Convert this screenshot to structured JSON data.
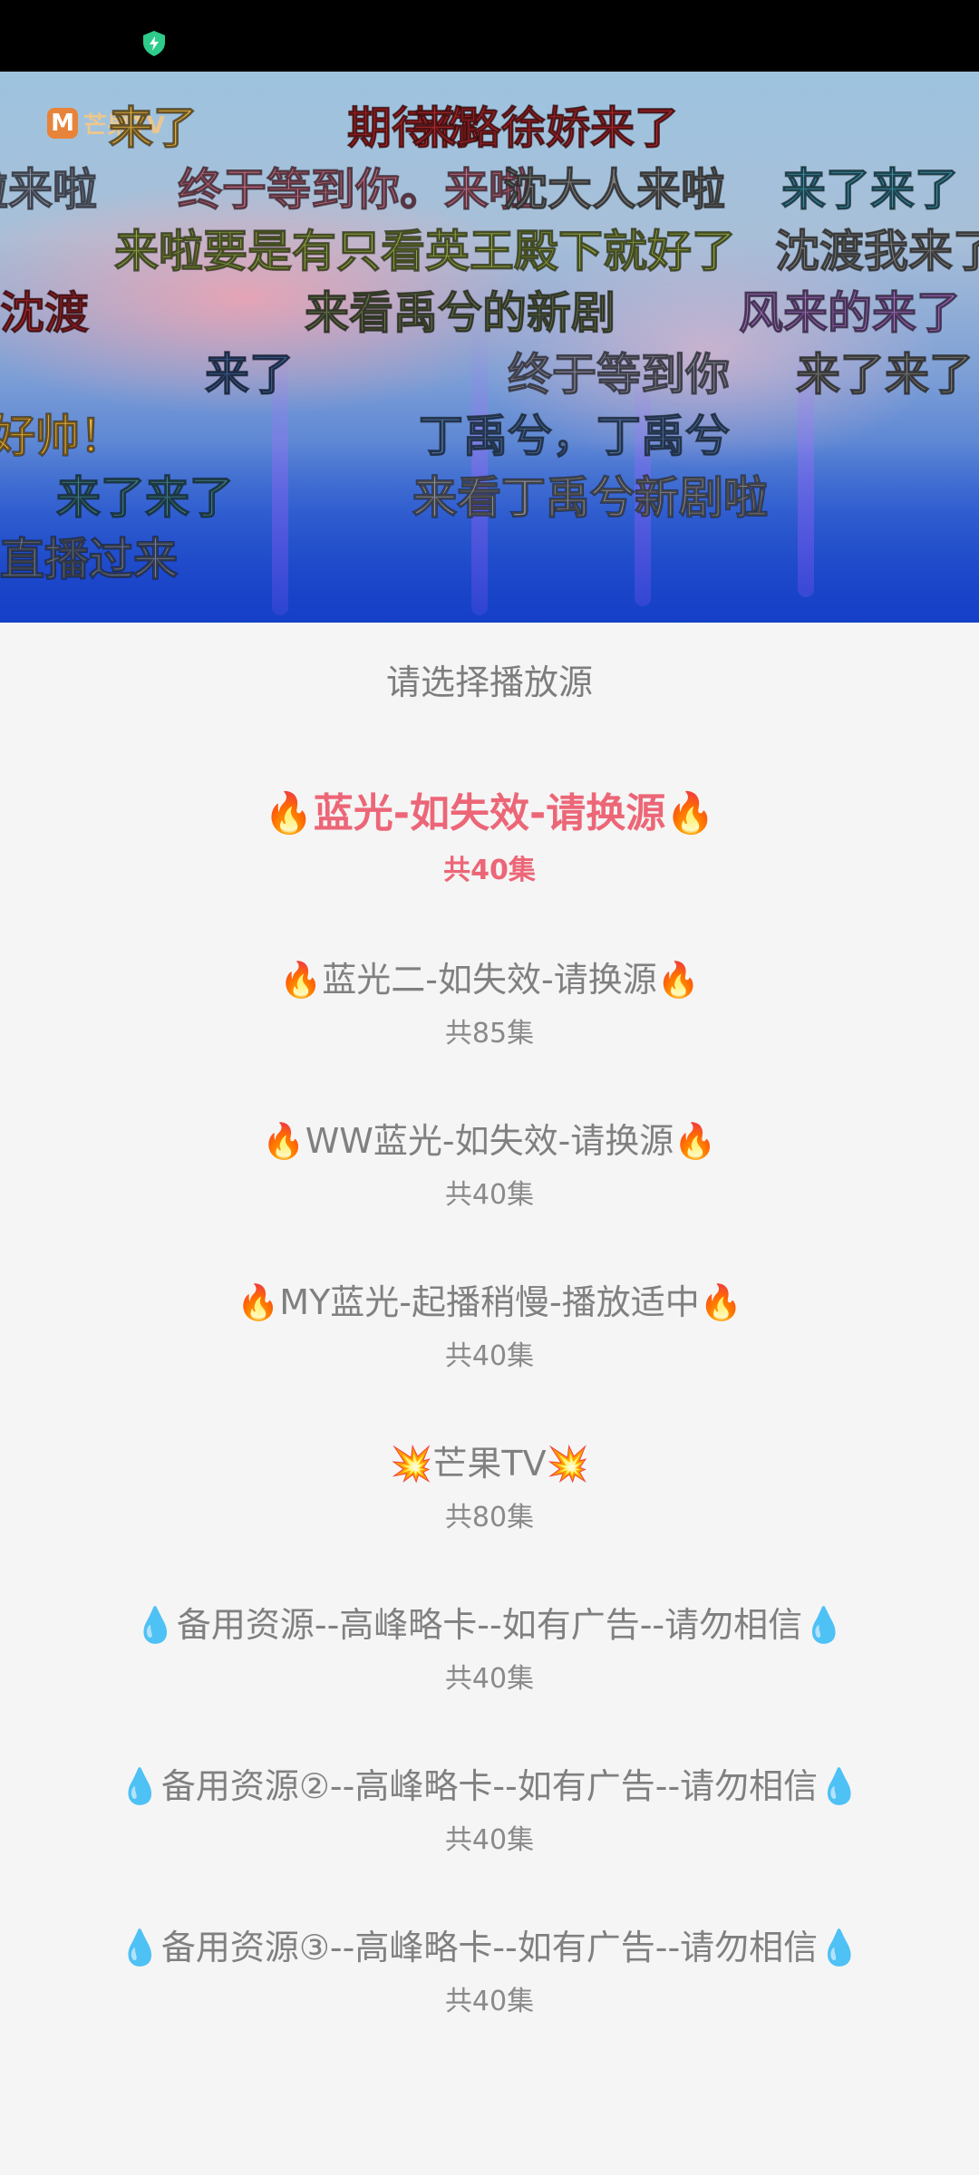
{
  "video": {
    "logo_text": "芒果TV",
    "danmaku": [
      "来了",
      "期待你",
      "来路徐娇来了",
      "啦来啦",
      "终于等到你。来啦",
      "沈大人来啦",
      "来了来了",
      "来啦要是有只看英王殿下就好了",
      "沈渡我来了",
      "沈渡",
      "来看禹兮的新剧",
      "风来的来了",
      "来了",
      "终于等到你",
      "来了来了",
      "好帅！",
      "丁禹兮，丁禹兮",
      "来了来了",
      "来看丁禹兮新剧啦",
      "直播过来"
    ]
  },
  "sources": {
    "title": "请选择播放源",
    "items": [
      {
        "name": "🔥蓝光-如失效-请换源🔥",
        "count": "共40集"
      },
      {
        "name": "🔥蓝光二-如失效-请换源🔥",
        "count": "共85集"
      },
      {
        "name": "🔥WW蓝光-如失效-请换源🔥",
        "count": "共40集"
      },
      {
        "name": "🔥MY蓝光-起播稍慢-播放适中🔥",
        "count": "共40集"
      },
      {
        "name": "💥芒果TV💥",
        "count": "共80集"
      },
      {
        "name": "💧备用资源--高峰略卡--如有广告--请勿相信💧",
        "count": "共40集"
      },
      {
        "name": "💧备用资源②--高峰略卡--如有广告--请勿相信💧",
        "count": "共40集"
      },
      {
        "name": "💧备用资源③--高峰略卡--如有广告--请勿相信💧",
        "count": "共40集"
      }
    ]
  },
  "colors": {
    "active": "#ec6677",
    "text": "#808080",
    "background": "#f5f5f5",
    "shield": "#2ecc8a"
  },
  "icons": {
    "status": "shield-icon"
  }
}
